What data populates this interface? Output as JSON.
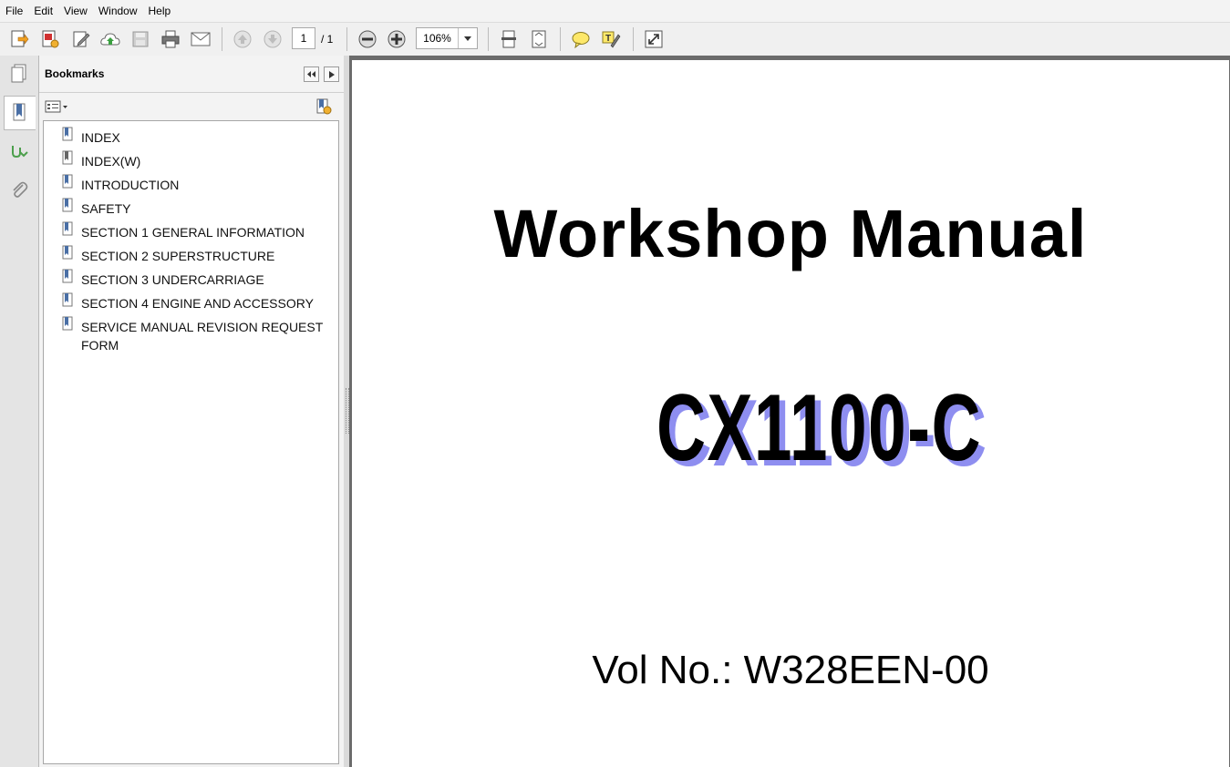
{
  "menu": [
    "File",
    "Edit",
    "View",
    "Window",
    "Help"
  ],
  "toolbar": {
    "page_current": "1",
    "page_total": "/ 1",
    "zoom": "106%"
  },
  "bookmarks": {
    "title": "Bookmarks",
    "items": [
      {
        "label": "INDEX",
        "icon": "bookmark-icon"
      },
      {
        "label": "INDEX(W)",
        "icon": "bookmark-icon"
      },
      {
        "label": "INTRODUCTION",
        "icon": "bookmark-icon"
      },
      {
        "label": "SAFETY",
        "icon": "bookmark-icon"
      },
      {
        "label": "SECTION 1 GENERAL INFORMATION",
        "icon": "bookmark-icon"
      },
      {
        "label": "SECTION 2 SUPERSTRUCTURE",
        "icon": "bookmark-icon"
      },
      {
        "label": "SECTION 3 UNDERCARRIAGE",
        "icon": "bookmark-icon"
      },
      {
        "label": "SECTION 4 ENGINE AND ACCESSORY",
        "icon": "bookmark-icon"
      },
      {
        "label": "SERVICE MANUAL REVISION REQUEST FORM",
        "icon": "bookmark-icon"
      }
    ]
  },
  "document": {
    "title": "Workshop Manual",
    "model": "CX1100-C",
    "volume": "Vol No.: W328EEN-00"
  },
  "colors": {
    "model_shadow": "#8e8ef0",
    "doc_background": "#6b6b6b",
    "bookmark_icon": "#4a6fa5"
  }
}
